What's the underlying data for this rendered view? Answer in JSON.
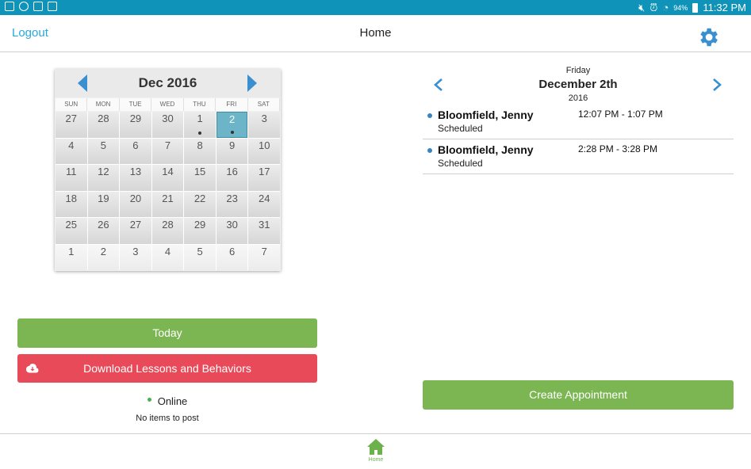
{
  "status_bar": {
    "battery": "94%",
    "time": "11:32 PM"
  },
  "app_bar": {
    "logout_label": "Logout",
    "title": "Home",
    "settings_icon": "gear-icon"
  },
  "calendar": {
    "month_label": "Dec 2016",
    "weekdays": [
      "SUN",
      "MON",
      "TUE",
      "WED",
      "THU",
      "FRI",
      "SAT"
    ],
    "weeks": [
      [
        "27",
        "28",
        "29",
        "30",
        "1",
        "2",
        "3"
      ],
      [
        "4",
        "5",
        "6",
        "7",
        "8",
        "9",
        "10"
      ],
      [
        "11",
        "12",
        "13",
        "14",
        "15",
        "16",
        "17"
      ],
      [
        "18",
        "19",
        "20",
        "21",
        "22",
        "23",
        "24"
      ],
      [
        "25",
        "26",
        "27",
        "28",
        "29",
        "30",
        "31"
      ],
      [
        "1",
        "2",
        "3",
        "4",
        "5",
        "6",
        "7"
      ]
    ],
    "selected_day": "2",
    "days_with_events": [
      "1",
      "2"
    ]
  },
  "actions": {
    "today_label": "Today",
    "download_label": "Download Lessons and Behaviors",
    "online_label": "Online",
    "post_status": "No items to post"
  },
  "day_view": {
    "weekday": "Friday",
    "date": "December 2th",
    "year": "2016",
    "appointments": [
      {
        "name": "Bloomfield, Jenny",
        "status": "Scheduled",
        "time": "12:07 PM - 1:07 PM"
      },
      {
        "name": "Bloomfield, Jenny",
        "status": "Scheduled",
        "time": "2:28 PM - 3:28 PM"
      }
    ],
    "create_label": "Create Appointment"
  },
  "bottom_nav": {
    "home_label": "Home"
  },
  "colors": {
    "status_bar": "#0f93b8",
    "link": "#2ba8d8",
    "green": "#7bb653",
    "red": "#e84a59",
    "selected_day": "#6cb4c7",
    "accent_blue": "#3a8fd0"
  }
}
